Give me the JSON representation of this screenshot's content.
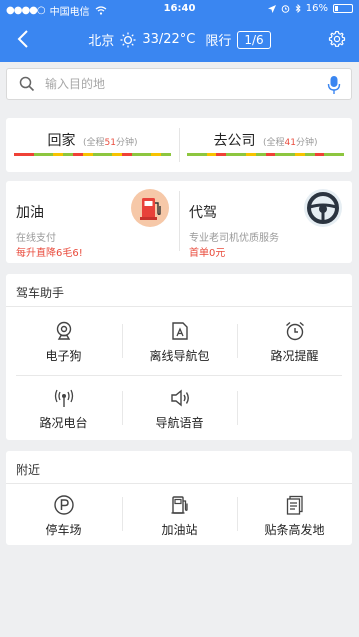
{
  "status_bar": {
    "carrier": "中国电信",
    "time": "16:40",
    "battery": "16%"
  },
  "top_bar": {
    "city": "北京",
    "temperature": "33/22°C",
    "limit_label": "限行",
    "limit_value": "1/6"
  },
  "search": {
    "placeholder": "输入目的地"
  },
  "commute": [
    {
      "title": "回家",
      "sub_prefix": "(全程",
      "minutes": "51",
      "sub_suffix": "分钟)",
      "traffic": [
        "#ef4136",
        "#ef4136",
        "#8dc63f",
        "#8dc63f",
        "#f7c300",
        "#8dc63f",
        "#ef4136",
        "#f7c300",
        "#8dc63f",
        "#8dc63f",
        "#f7c300",
        "#ef4136",
        "#8dc63f",
        "#8dc63f",
        "#f7c300",
        "#8dc63f"
      ]
    },
    {
      "title": "去公司",
      "sub_prefix": "(全程",
      "minutes": "41",
      "sub_suffix": "分钟)",
      "traffic": [
        "#8dc63f",
        "#8dc63f",
        "#f7c300",
        "#ef4136",
        "#8dc63f",
        "#8dc63f",
        "#f7c300",
        "#8dc63f",
        "#ef4136",
        "#8dc63f",
        "#8dc63f",
        "#f7c300",
        "#8dc63f",
        "#ef4136",
        "#8dc63f",
        "#8dc63f"
      ]
    }
  ],
  "services": [
    {
      "name": "加油",
      "desc": "在线支付",
      "promo": "每升直降6毛6!"
    },
    {
      "name": "代驾",
      "desc": "专业老司机优质服务",
      "promo": "首单0元"
    }
  ],
  "assistant": {
    "title": "驾车助手",
    "items": [
      {
        "label": "电子狗",
        "icon": "camera-icon"
      },
      {
        "label": "离线导航包",
        "icon": "offline-map-icon"
      },
      {
        "label": "路况提醒",
        "icon": "alarm-clock-icon"
      },
      {
        "label": "路况电台",
        "icon": "radio-icon"
      },
      {
        "label": "导航语音",
        "icon": "speaker-icon"
      }
    ]
  },
  "nearby": {
    "title": "附近",
    "items": [
      {
        "label": "停车场",
        "icon": "parking-icon"
      },
      {
        "label": "加油站",
        "icon": "gas-station-icon"
      },
      {
        "label": "贴条高发地",
        "icon": "ticket-icon"
      }
    ]
  },
  "colors": {
    "brand_blue": "#3a86f1",
    "accent_red": "#e94b3c",
    "background": "#eeeff1"
  }
}
